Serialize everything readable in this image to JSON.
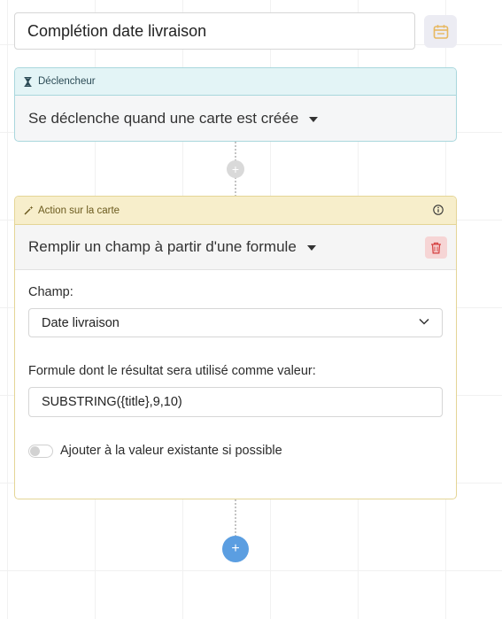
{
  "automation": {
    "name_value": "Complétion date livraison",
    "calendar_icon": "calendar-icon"
  },
  "trigger": {
    "header_label": "Déclencheur",
    "header_icon": "hourglass-icon",
    "selected": "Se déclenche quand une carte est créée"
  },
  "action": {
    "header_label": "Action sur la carte",
    "header_icon": "magic-wand-icon",
    "info_icon": "info-icon",
    "selected": "Remplir un champ à partir d'une formule",
    "delete_icon": "trash-icon",
    "field_label": "Champ:",
    "field_value": "Date livraison",
    "formula_label": "Formule dont le résultat sera utilisé comme valeur:",
    "formula_value": "SUBSTRING({title},9,10)",
    "toggle_label": "Ajouter à la valeur existante si possible",
    "toggle_on": false
  },
  "add_buttons": {
    "glyph": "+"
  },
  "colors": {
    "trigger_accent": "#a9d7dd",
    "action_accent": "#e4d596",
    "add_button": "#5b9ee1",
    "delete_bg": "#f6d5d5"
  }
}
